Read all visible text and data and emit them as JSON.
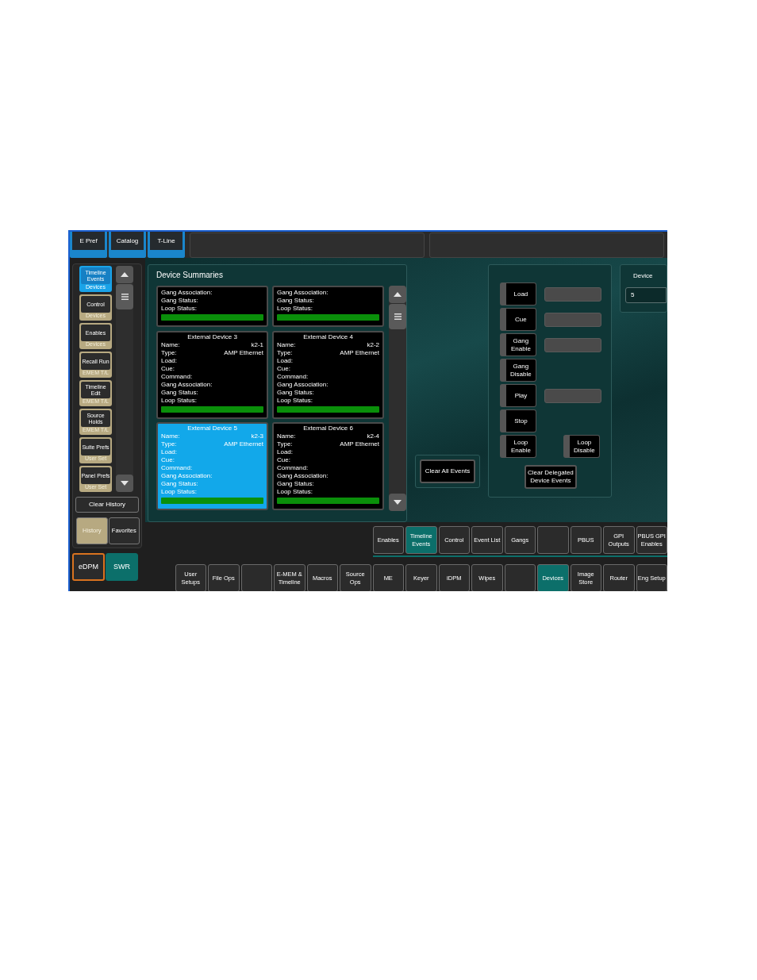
{
  "top_tabs": [
    {
      "label": "E Pref"
    },
    {
      "label": "Catalog"
    },
    {
      "label": "T-Line"
    }
  ],
  "history_list": [
    {
      "label": "Timeline Events",
      "sub": "Devices",
      "selected": true
    },
    {
      "label": "Control",
      "sub": "Devices",
      "selected": false
    },
    {
      "label": "Enables",
      "sub": "Devices",
      "selected": false
    },
    {
      "label": "Recall Run",
      "sub": "EMEM T/L",
      "selected": false
    },
    {
      "label": "Timeline Edit",
      "sub": "EMEM T/L",
      "selected": false
    },
    {
      "label": "Source Holds",
      "sub": "EMEM T/L",
      "selected": false
    },
    {
      "label": "Suite Prefs",
      "sub": "User Set",
      "selected": false
    },
    {
      "label": "Panel Prefs",
      "sub": "User Set",
      "selected": false
    }
  ],
  "clear_history": "Clear History",
  "sidebar_tabs": [
    {
      "label": "History",
      "selected": true
    },
    {
      "label": "Favorites",
      "selected": false
    }
  ],
  "mode_buttons": [
    {
      "label": "eDPM",
      "kind": "outlined"
    },
    {
      "label": "SWR",
      "kind": "active"
    }
  ],
  "device_summaries": {
    "title": "Device Summaries",
    "cards": [
      {
        "selected": false,
        "fields": [
          {
            "label": "Gang Association:"
          },
          {
            "label": "Gang Status:"
          },
          {
            "label": "Loop Status:"
          }
        ]
      },
      {
        "selected": false,
        "fields": [
          {
            "label": "Gang Association:"
          },
          {
            "label": "Gang Status:"
          },
          {
            "label": "Loop Status:"
          }
        ]
      },
      {
        "title": "External Device 3",
        "selected": false,
        "fields": [
          {
            "label": "Name:",
            "value": "k2-1"
          },
          {
            "label": "Type:",
            "value": "AMP Ethernet"
          },
          {
            "label": "Load:"
          },
          {
            "label": "Cue:"
          },
          {
            "label": "Command:"
          },
          {
            "label": "Gang Association:"
          },
          {
            "label": "Gang Status:"
          },
          {
            "label": "Loop Status:"
          }
        ]
      },
      {
        "title": "External Device 4",
        "selected": false,
        "fields": [
          {
            "label": "Name:",
            "value": "k2-2"
          },
          {
            "label": "Type:",
            "value": "AMP Ethernet"
          },
          {
            "label": "Load:"
          },
          {
            "label": "Cue:"
          },
          {
            "label": "Command:"
          },
          {
            "label": "Gang Association:"
          },
          {
            "label": "Gang Status:"
          },
          {
            "label": "Loop Status:"
          }
        ]
      },
      {
        "title": "External Device 5",
        "selected": true,
        "fields": [
          {
            "label": "Name:",
            "value": "k2-3"
          },
          {
            "label": "Type:",
            "value": "AMP Ethernet"
          },
          {
            "label": "Load:"
          },
          {
            "label": "Cue:"
          },
          {
            "label": "Command:"
          },
          {
            "label": "Gang Association:"
          },
          {
            "label": "Gang Status:"
          },
          {
            "label": "Loop Status:"
          }
        ]
      },
      {
        "title": "External Device 6",
        "selected": false,
        "fields": [
          {
            "label": "Name:",
            "value": "k2-4"
          },
          {
            "label": "Type:",
            "value": "AMP Ethernet"
          },
          {
            "label": "Load:"
          },
          {
            "label": "Cue:"
          },
          {
            "label": "Command:"
          },
          {
            "label": "Gang Association:"
          },
          {
            "label": "Gang Status:"
          },
          {
            "label": "Loop Status:"
          }
        ]
      }
    ]
  },
  "clear_all_events": "Clear All Events",
  "controls": [
    {
      "label": "Load",
      "field": true
    },
    {
      "label": "Cue",
      "field": true
    },
    {
      "label": "Gang Enable",
      "field": true
    },
    {
      "label": "Gang Disable",
      "field": false
    },
    {
      "label": "Play",
      "field": true
    },
    {
      "label": "Stop",
      "field": false
    },
    {
      "label": "Loop Enable",
      "field": false,
      "paired_button": "Loop Disable"
    }
  ],
  "clear_delegated": "Clear Delegated Device Events",
  "device": {
    "label": "Device",
    "value": "5"
  },
  "sub_menu": [
    {
      "label": "Enables",
      "selected": false
    },
    {
      "label": "Timeline Events",
      "selected": true
    },
    {
      "label": "Control",
      "selected": false
    },
    {
      "label": "Event List",
      "selected": false
    },
    {
      "label": "Gangs",
      "selected": false
    },
    {
      "selected": false
    },
    {
      "label": "PBUS",
      "selected": false
    },
    {
      "label": "GPI Outputs",
      "selected": false
    },
    {
      "label": "PBUS GPI Enables",
      "selected": false
    }
  ],
  "main_menu": [
    {
      "label": "User Setups",
      "selected": false
    },
    {
      "label": "File Ops",
      "selected": false
    },
    {
      "selected": false
    },
    {
      "label": "E-MEM & Timeline",
      "selected": false
    },
    {
      "label": "Macros",
      "selected": false
    },
    {
      "label": "Source Ops",
      "selected": false
    },
    {
      "label": "ME",
      "selected": false
    },
    {
      "label": "Keyer",
      "selected": false
    },
    {
      "label": "iDPM",
      "selected": false
    },
    {
      "label": "Wipes",
      "selected": false
    },
    {
      "selected": false
    },
    {
      "label": "Devices",
      "selected": true
    },
    {
      "label": "Image Store",
      "selected": false
    },
    {
      "label": "Router",
      "selected": false
    },
    {
      "label": "Eng Setup",
      "selected": false
    }
  ]
}
